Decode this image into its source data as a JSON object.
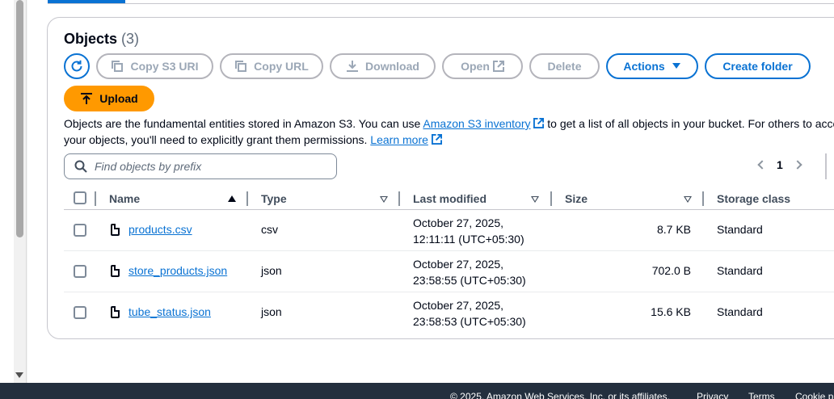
{
  "objects": {
    "title": "Objects",
    "count": "(3)"
  },
  "toolbar": {
    "copy_s3_uri": "Copy S3 URI",
    "copy_url": "Copy URL",
    "download": "Download",
    "open": "Open",
    "delete": "Delete",
    "actions": "Actions",
    "create_folder": "Create folder",
    "upload": "Upload"
  },
  "description": {
    "part1": "Objects are the fundamental entities stored in Amazon S3. You can use",
    "inventory_link": "Amazon S3 inventory",
    "part2": "to get a list of all objects in your bucket. For others to access your objects, you'll need to explicitly grant them permissions.",
    "learn_more": "Learn more"
  },
  "search": {
    "placeholder": "Find objects by prefix",
    "value": ""
  },
  "pagination": {
    "current_page": "1"
  },
  "table": {
    "columns": [
      "Name",
      "Type",
      "Last modified",
      "Size",
      "Storage class"
    ],
    "rows": [
      {
        "name": "products.csv",
        "type": "csv",
        "modified_line1": "October 27, 2025,",
        "modified_line2": "12:11:11 (UTC+05:30)",
        "size": "8.7 KB",
        "storage": "Standard"
      },
      {
        "name": "store_products.json",
        "type": "json",
        "modified_line1": "October 27, 2025,",
        "modified_line2": "23:58:55 (UTC+05:30)",
        "size": "702.0 B",
        "storage": "Standard"
      },
      {
        "name": "tube_status.json",
        "type": "json",
        "modified_line1": "October 27, 2025,",
        "modified_line2": "23:58:53 (UTC+05:30)",
        "size": "15.6 KB",
        "storage": "Standard"
      }
    ]
  },
  "footer": {
    "copyright": "© 2025, Amazon Web Services, Inc. or its affiliates.",
    "privacy": "Privacy",
    "terms": "Terms",
    "cookie": "Cookie p"
  },
  "colors": {
    "accent_blue": "#0972d3",
    "upload_orange": "#ff9900",
    "footer_bg": "#232f3e"
  }
}
